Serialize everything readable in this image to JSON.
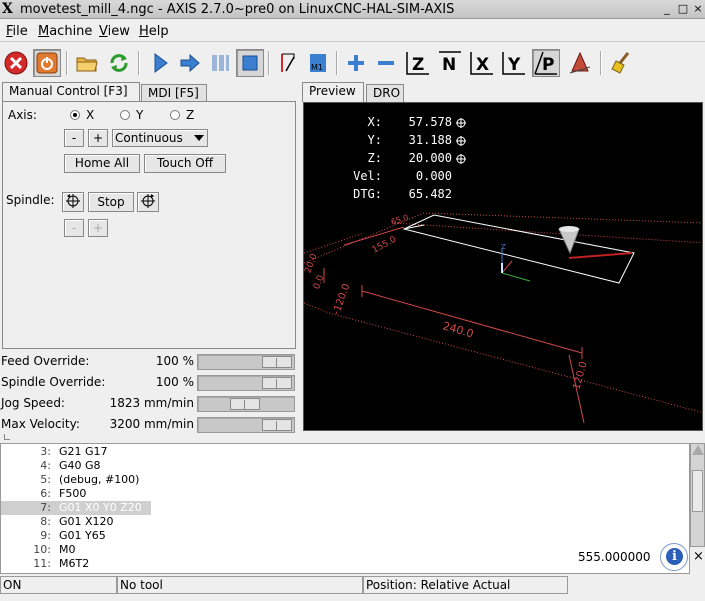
{
  "window": {
    "title": "movetest_mill_4.ngc - AXIS 2.7.0~pre0 on LinuxCNC-HAL-SIM-AXIS",
    "app_icon": "X",
    "controls": [
      "_",
      "□",
      "×"
    ]
  },
  "menubar": {
    "items": [
      "File",
      "Machine",
      "View",
      "Help"
    ]
  },
  "toolbar": {
    "icons": [
      "estop-icon",
      "machine-power-icon",
      "open-file-icon",
      "reload-icon",
      "run-icon",
      "step-icon",
      "pause-icon",
      "stop-icon",
      "skip-block-icon",
      "optional-stop-icon",
      "zoom-in-icon",
      "zoom-out-icon",
      "view-z-icon",
      "view-z2-icon",
      "view-x-icon",
      "view-y-icon",
      "view-p-icon",
      "tool-path-icon",
      "clear-plot-icon"
    ]
  },
  "left_tabs": [
    "Manual Control [F3]",
    "MDI [F5]"
  ],
  "manual": {
    "axis_label": "Axis:",
    "axes": [
      "X",
      "Y",
      "Z"
    ],
    "selected_axis": "X",
    "minus": "-",
    "plus": "+",
    "jog_mode": "Continuous",
    "home_all": "Home All",
    "touch_off": "Touch Off",
    "spindle_label": "Spindle:",
    "spindle_stop": "Stop",
    "spindle_minus": "-",
    "spindle_plus": "+"
  },
  "sliders": [
    {
      "label": "Feed Override:",
      "value": "100 %",
      "level": 1.0
    },
    {
      "label": "Spindle Override:",
      "value": "100 %",
      "level": 1.0
    },
    {
      "label": "Jog Speed:",
      "value": "1823 mm/min",
      "level": 0.5
    },
    {
      "label": "Max Velocity:",
      "value": "3200 mm/min",
      "level": 1.0
    }
  ],
  "right_tabs": [
    "Preview",
    "DRO"
  ],
  "dro": [
    {
      "label": "X:",
      "value": "57.578"
    },
    {
      "label": "Y:",
      "value": "31.188"
    },
    {
      "label": "Z:",
      "value": "20.000"
    },
    {
      "label": "Vel:",
      "value": "0.000"
    },
    {
      "label": "DTG:",
      "value": "65.482"
    }
  ],
  "preview_dims": {
    "top_small": "65.0",
    "left_dim": "155.0",
    "z_a": "20.0",
    "z_b": "0.0",
    "x_min": "-120.0",
    "width": "240.0",
    "depth": "120.0",
    "axis_z": "Z"
  },
  "gcode": [
    {
      "n": "3:",
      "code": "G21 G17"
    },
    {
      "n": "4:",
      "code": "G40 G8"
    },
    {
      "n": "5:",
      "code": "(debug, #100)"
    },
    {
      "n": "6:",
      "code": "F500"
    },
    {
      "n": "7:",
      "code": "G01 X0 Y0 Z20"
    },
    {
      "n": "8:",
      "code": "G01 X120"
    },
    {
      "n": "9:",
      "code": "G01 Y65"
    },
    {
      "n": "10:",
      "code": "M0"
    },
    {
      "n": "11:",
      "code": "M6T2"
    }
  ],
  "selected_line": "7:",
  "debug_value": "555.000000",
  "info_icon": "i",
  "close_msg": "×",
  "status": {
    "state": "ON",
    "tool": "No tool",
    "position": "Position: Relative Actual"
  },
  "colors": {
    "preview_bg": "#000000",
    "limits": "#d04a4a",
    "path": "#ffffff",
    "feed_path": "#c02020",
    "accent_blue": "#3a7fd0"
  }
}
